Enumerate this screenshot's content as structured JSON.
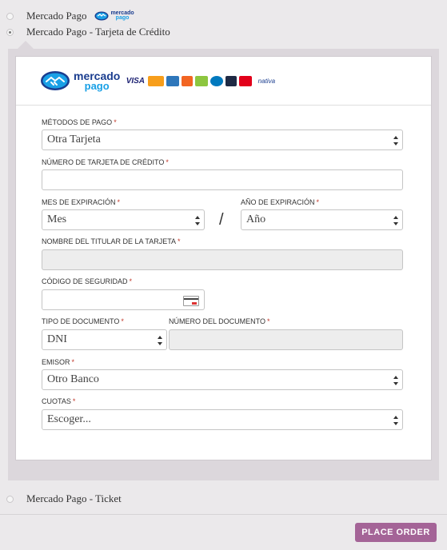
{
  "payment_options": [
    {
      "label": "Mercado Pago",
      "selected": false
    },
    {
      "label": "Mercado Pago - Tarjeta de Crédito",
      "selected": true
    },
    {
      "label": "Mercado Pago - Ticket",
      "selected": false
    }
  ],
  "mini_logo": {
    "t1": "mercado",
    "t2": "pago"
  },
  "header": {
    "brand_t1": "mercado",
    "brand_t2": "pago",
    "card_logos": [
      "VISA",
      "",
      "",
      "",
      "",
      "",
      "",
      "",
      "nativa"
    ]
  },
  "form": {
    "metodos_label": "MÉTODOS DE PAGO",
    "metodos_value": "Otra Tarjeta",
    "numero_label": "NÚMERO DE TARJETA DE CRÉDITO",
    "numero_value": "",
    "mes_label": "MES DE EXPIRACIÓN",
    "mes_value": "Mes",
    "slash": "/",
    "anio_label": "AÑO DE EXPIRACIÓN",
    "anio_value": "Año",
    "titular_label": "NOMBRE DEL TITULAR DE LA TARJETA",
    "titular_value": "",
    "codigo_label": "CÓDIGO DE SEGURIDAD",
    "codigo_value": "",
    "tipo_doc_label": "TIPO DE DOCUMENTO",
    "tipo_doc_value": "DNI",
    "num_doc_label": "NÚMERO DEL DOCUMENTO",
    "num_doc_value": "",
    "emisor_label": "EMISOR",
    "emisor_value": "Otro Banco",
    "cuotas_label": "CUOTAS",
    "cuotas_value": "Escoger...",
    "required_mark": "*"
  },
  "place_order_label": "PLACE ORDER",
  "colors": {
    "accent": "#a46497",
    "required": "#c0392b",
    "brand_dark": "#1a3d8f",
    "brand_light": "#19a0e6"
  }
}
